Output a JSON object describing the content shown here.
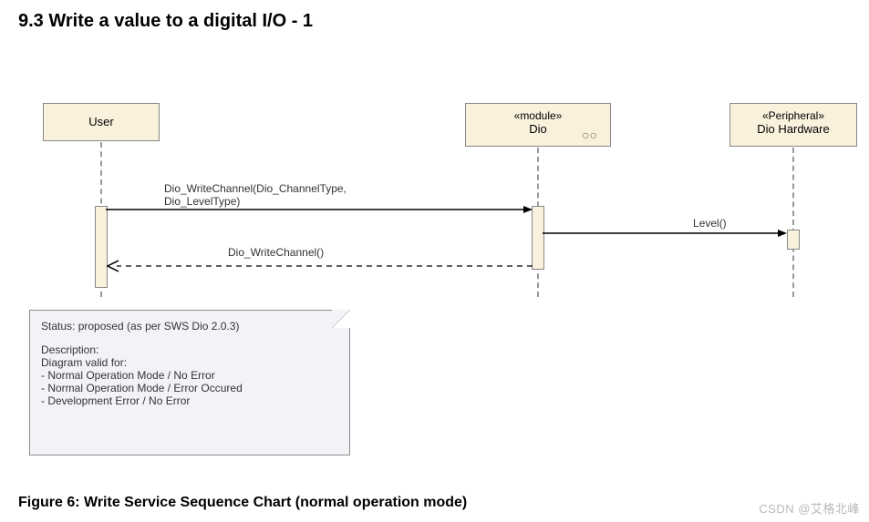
{
  "heading": "9.3   Write a value to a digital I/O - 1",
  "caption": "Figure 6: Write Service Sequence Chart (normal operation mode)",
  "watermark": "CSDN @艾格北峰",
  "lifelines": {
    "user": {
      "name": "User"
    },
    "dio": {
      "stereotype": "«module»",
      "name": "Dio"
    },
    "periph": {
      "stereotype": "«Peripheral»",
      "name": "Dio Hardware"
    }
  },
  "messages": {
    "m1": "Dio_WriteChannel(Dio_ChannelType,\nDio_LevelType)",
    "m2": "Level()",
    "m3": "Dio_WriteChannel()"
  },
  "note": {
    "status_label": "Status: proposed (as per SWS Dio 2.0.3)",
    "desc_label": "Description:",
    "desc_l1": "Diagram valid for:",
    "desc_l2": "- Normal Operation Mode / No Error",
    "desc_l3": "- Normal Operation Mode / Error Occured",
    "desc_l4": "- Development Error / No Error"
  },
  "chart_data": {
    "type": "sequence-diagram",
    "title": "Write Service Sequence Chart (normal operation mode)",
    "lifelines": [
      {
        "id": "User",
        "stereotype": null
      },
      {
        "id": "Dio",
        "stereotype": "module"
      },
      {
        "id": "Dio Hardware",
        "stereotype": "Peripheral"
      }
    ],
    "messages": [
      {
        "from": "User",
        "to": "Dio",
        "kind": "sync",
        "label": "Dio_WriteChannel(Dio_ChannelType, Dio_LevelType)"
      },
      {
        "from": "Dio",
        "to": "Dio Hardware",
        "kind": "sync",
        "label": "Level()"
      },
      {
        "from": "Dio",
        "to": "User",
        "kind": "return",
        "label": "Dio_WriteChannel()"
      }
    ],
    "note": "Status: proposed (as per SWS Dio 2.0.3). Diagram valid for: Normal Operation Mode / No Error; Normal Operation Mode / Error Occured; Development Error / No Error"
  }
}
